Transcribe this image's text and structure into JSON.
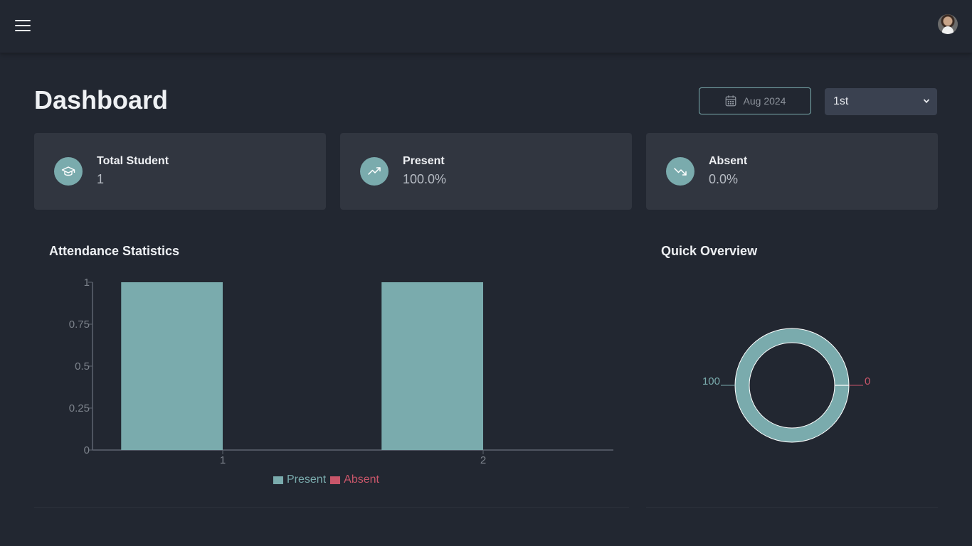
{
  "header": {
    "menu_icon": "hamburger-icon",
    "avatar_icon": "user-avatar"
  },
  "page": {
    "title": "Dashboard"
  },
  "filters": {
    "date_label": "Aug 2024",
    "date_icon": "calendar-icon",
    "period_value": "1st",
    "period_icon": "chevron-down-icon"
  },
  "stats": [
    {
      "label": "Total Student",
      "value": "1",
      "icon": "graduation-cap-icon"
    },
    {
      "label": "Present",
      "value": "100.0%",
      "icon": "trending-up-icon"
    },
    {
      "label": "Absent",
      "value": "0.0%",
      "icon": "trending-down-icon"
    }
  ],
  "attendance_panel": {
    "title": "Attendance Statistics"
  },
  "overview_panel": {
    "title": "Quick Overview"
  },
  "colors": {
    "present": "#7aabad",
    "absent": "#c9566a",
    "axis": "#5d6470",
    "tick_text": "#7d838c"
  },
  "chart_data": [
    {
      "type": "bar",
      "categories": [
        "1",
        "2"
      ],
      "series": [
        {
          "name": "Present",
          "values": [
            1,
            1
          ]
        },
        {
          "name": "Absent",
          "values": [
            0,
            0
          ]
        }
      ],
      "yticks": [
        "0",
        "0.25",
        "0.5",
        "0.75",
        "1"
      ],
      "ylim": [
        0,
        1
      ],
      "legend": "bottom"
    },
    {
      "type": "pie",
      "categories": [
        "Present",
        "Absent"
      ],
      "values": [
        100,
        0
      ],
      "labels": [
        "100",
        "0"
      ]
    }
  ]
}
